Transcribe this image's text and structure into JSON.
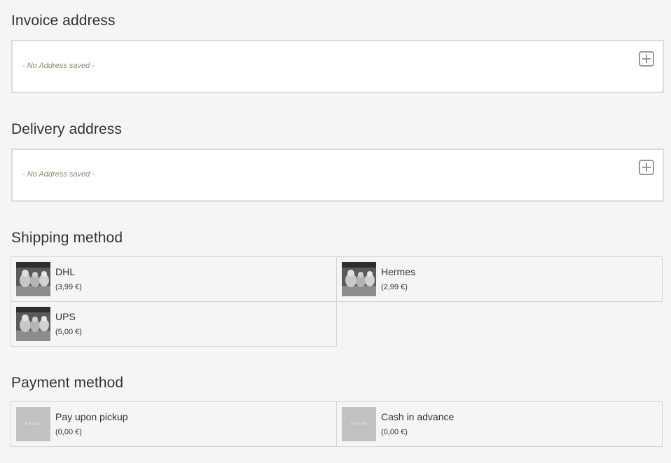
{
  "invoice": {
    "title": "Invoice address",
    "empty_text": "- No Address saved -"
  },
  "delivery": {
    "title": "Delivery address",
    "empty_text": "- No Address saved -"
  },
  "shipping": {
    "title": "Shipping method",
    "options": [
      {
        "name": "DHL",
        "price": "(3,99 €)",
        "icon": "cats-photo"
      },
      {
        "name": "Hermes",
        "price": "(2,99 €)",
        "icon": "cats-photo"
      },
      {
        "name": "UPS",
        "price": "(5,00 €)",
        "icon": "cats-photo"
      }
    ]
  },
  "payment": {
    "title": "Payment method",
    "options": [
      {
        "name": "Pay upon pickup",
        "price": "(0,00 €)",
        "icon": "placeholder-image",
        "thumb_text": "60×60"
      },
      {
        "name": "Cash in advance",
        "price": "(0,00 €)",
        "icon": "placeholder-image",
        "thumb_text": "60×60"
      }
    ]
  },
  "colors": {
    "background": "#f5f5f7",
    "border": "#d5d5d5",
    "muted_text": "#8a8a6e"
  }
}
